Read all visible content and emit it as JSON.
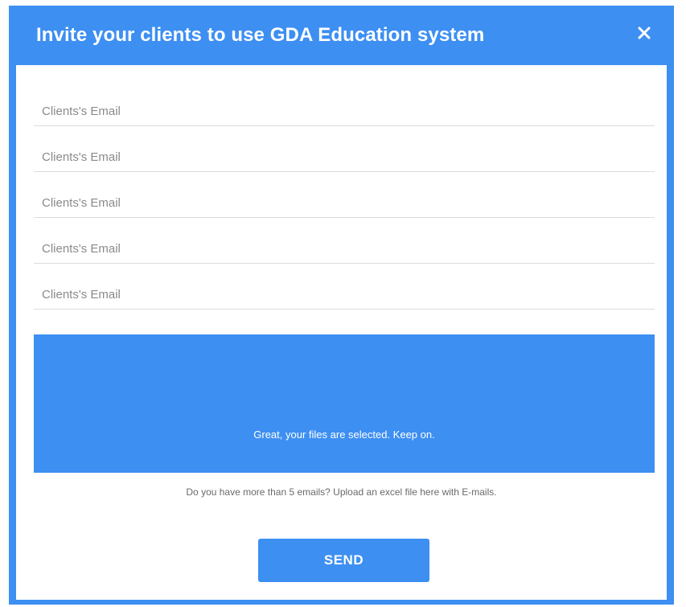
{
  "dialog": {
    "title": "Invite your clients to use GDA Education system",
    "close_icon": "close-icon"
  },
  "email_fields": [
    {
      "placeholder": "Clients's Email",
      "value": ""
    },
    {
      "placeholder": "Clients's Email",
      "value": ""
    },
    {
      "placeholder": "Clients's Email",
      "value": ""
    },
    {
      "placeholder": "Clients's Email",
      "value": ""
    },
    {
      "placeholder": "Clients's Email",
      "value": ""
    }
  ],
  "upload": {
    "status_message": "Great, your files are selected. Keep on.",
    "hint": "Do you have more than 5 emails? Upload an excel file here with E-mails."
  },
  "actions": {
    "send_label": "SEND"
  },
  "colors": {
    "accent": "#3d8ff2",
    "surface": "#ffffff",
    "placeholder_text": "#8a8a8a",
    "divider": "#dcdcdc"
  }
}
